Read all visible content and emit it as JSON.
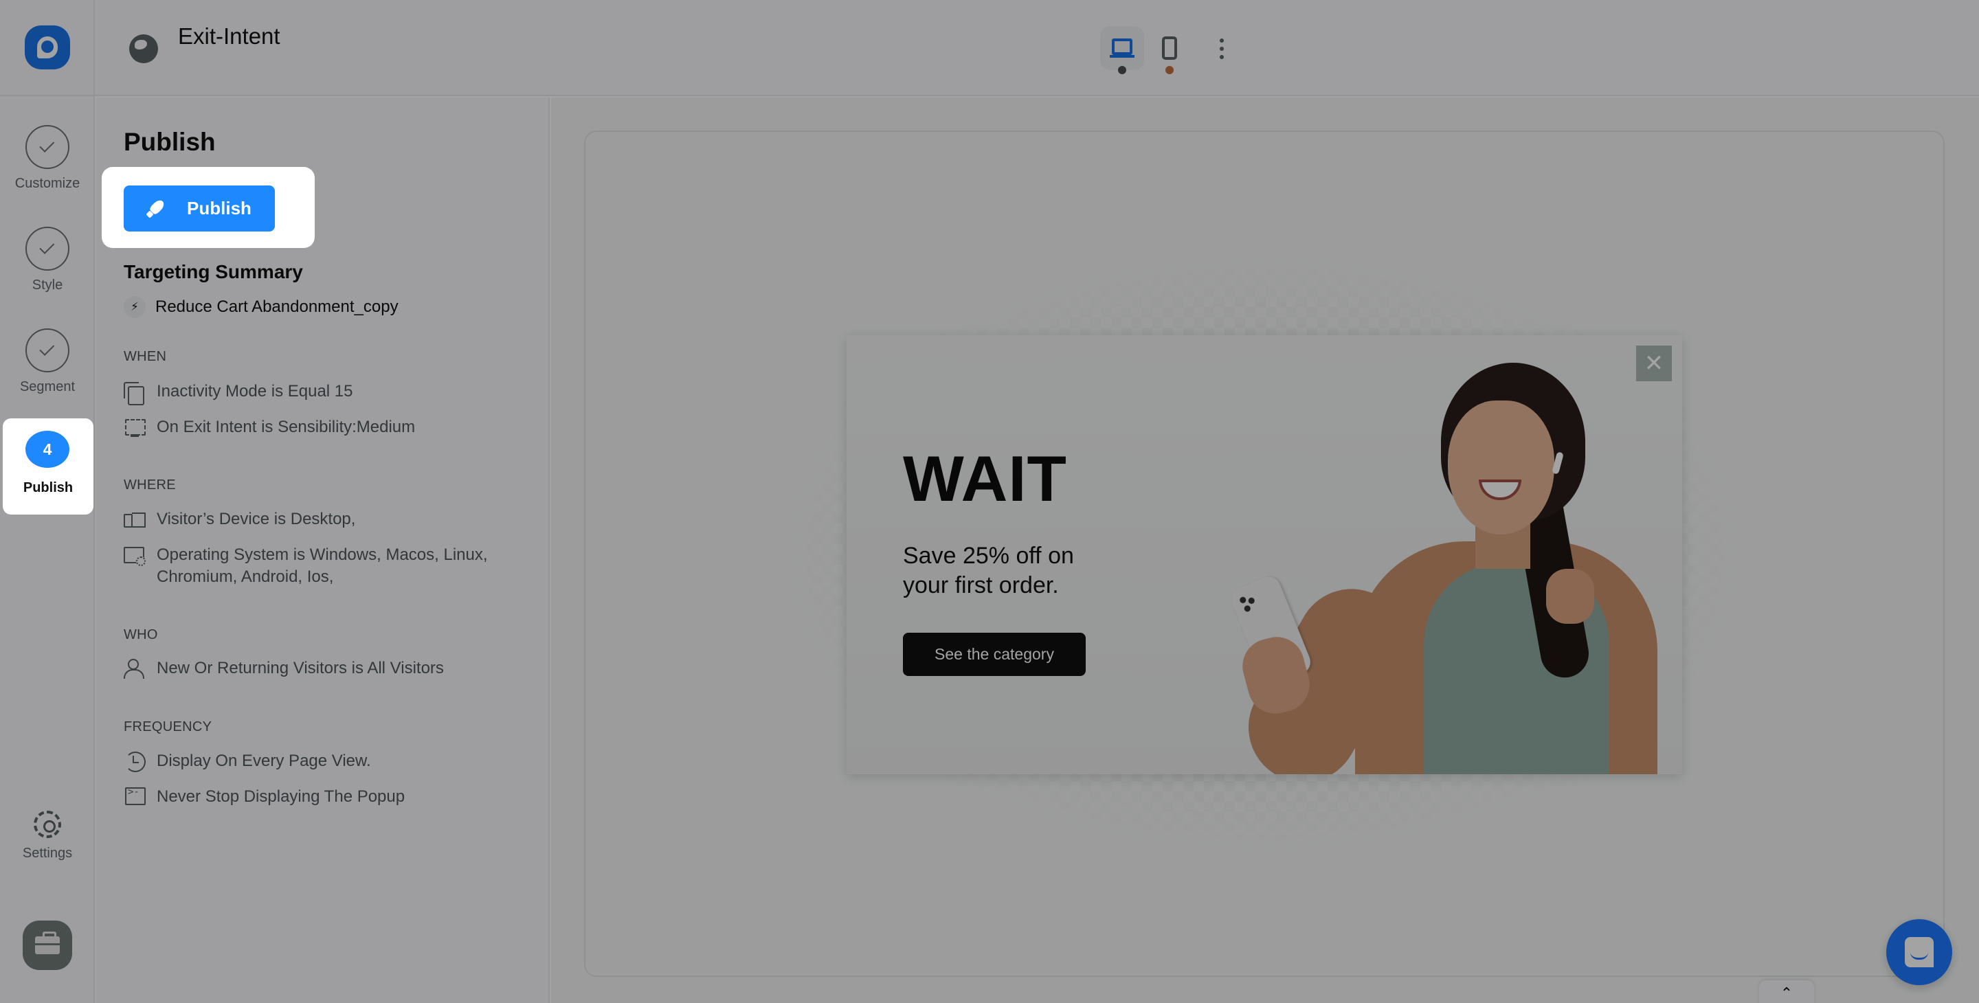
{
  "header": {
    "title": "Exit-Intent",
    "globe_icon": "globe-icon",
    "device_modes": [
      {
        "name": "desktop",
        "icon": "laptop-icon",
        "active": true,
        "indicator_color": "#4a4f52"
      },
      {
        "name": "mobile",
        "icon": "phone-icon",
        "active": false,
        "indicator_color": "#7a4a2e"
      }
    ],
    "more_icon": "kebab-menu-icon"
  },
  "rail": {
    "logo_icon": "app-logo",
    "steps": [
      {
        "label": "Customize",
        "state": "done",
        "icon": "check-icon"
      },
      {
        "label": "Style",
        "state": "done",
        "icon": "check-icon"
      },
      {
        "label": "Segment",
        "state": "done",
        "icon": "check-icon"
      },
      {
        "label": "Publish",
        "state": "active",
        "number": "4"
      }
    ],
    "settings_label": "Settings",
    "briefcase_icon": "briefcase-icon"
  },
  "panel": {
    "title": "Publish",
    "publish_button": "Publish",
    "targeting_title": "Targeting Summary",
    "campaign_name": "Reduce Cart Abandonment_copy",
    "sections": [
      {
        "label": "WHEN",
        "rules": [
          {
            "icon": "copy-icon",
            "text": "Inactivity Mode is Equal 15"
          },
          {
            "icon": "exit-monitor-icon",
            "text": "On Exit Intent is Sensibility:Medium"
          }
        ]
      },
      {
        "label": "WHERE",
        "rules": [
          {
            "icon": "devices-icon",
            "text": "Visitor’s Device is Desktop,"
          },
          {
            "icon": "os-settings-icon",
            "text": "Operating System is Windows, Macos, Linux, Chromium, Android, Ios,"
          }
        ]
      },
      {
        "label": "WHO",
        "rules": [
          {
            "icon": "users-icon",
            "text": "New Or Returning Visitors is All Visitors"
          }
        ]
      },
      {
        "label": "FREQUENCY",
        "rules": [
          {
            "icon": "history-icon",
            "text": "Display On Every Page View."
          },
          {
            "icon": "terminal-monitor-icon",
            "text": "Never Stop Displaying The Popup"
          }
        ]
      }
    ]
  },
  "popup": {
    "headline": "WAIT",
    "subtext": "Save 25% off on your first order.",
    "cta": "See the category",
    "close": "✕"
  },
  "widgets": {
    "chat_icon": "chat-icon",
    "collapse_glyph": "⌃"
  },
  "colors": {
    "accent": "#1e88ff",
    "logo": "#1a73e8",
    "overlay": "rgba(0,0,0,0.36)"
  }
}
